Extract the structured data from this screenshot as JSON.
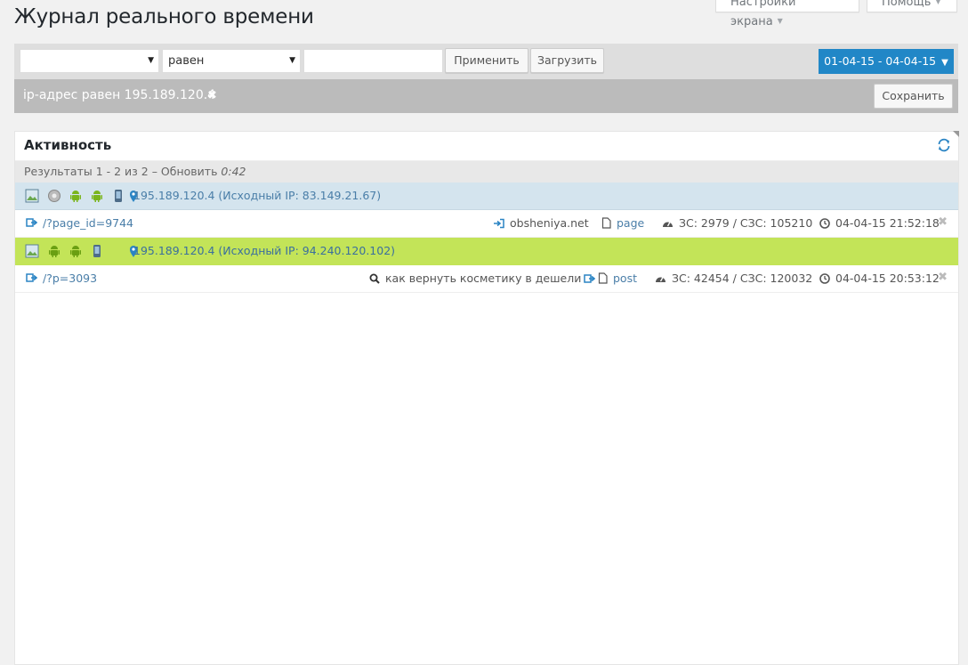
{
  "page": {
    "title": "Журнал реального времени"
  },
  "top_tabs": {
    "screen_options": "Настройки экрана",
    "help": "Помощь"
  },
  "filter": {
    "field_value": "",
    "operator_value": "равен",
    "text_value": "",
    "apply_label": "Применить",
    "load_label": "Загрузить",
    "date_range": "01-04-15 - 04-04-15"
  },
  "active_filter": {
    "tag": "ip-адрес равен 195.189.120.4",
    "save_label": "Сохранить"
  },
  "panel": {
    "title": "Активность",
    "results_text": "Результаты 1 - 2 из 2 – Обновить",
    "results_time": "0:42"
  },
  "visitors": [
    {
      "ip": "195.189.120.4 (Исходный IP: 83.149.21.67)",
      "icons": [
        "screen-res-icon",
        "browser-icon",
        "android-icon",
        "android-icon",
        "mobile-device-icon",
        "location-pin-icon"
      ],
      "hit": {
        "url": "/?page_id=9744",
        "referrer": "obsheniya.net",
        "content_type": "page",
        "stats": "ЗС: 2979 / СЗС: 105210",
        "time": "04-04-15 21:52:18"
      }
    },
    {
      "ip": "195.189.120.4 (Исходный IP: 94.240.120.102)",
      "icons": [
        "screen-res-icon",
        "android-icon",
        "android-icon",
        "mobile-device-icon",
        "location-pin-icon"
      ],
      "hit": {
        "url": "/?p=3093",
        "search_query": "как вернуть косметику в дешели",
        "content_type": "post",
        "stats": "ЗС: 42454 / СЗС: 120032",
        "time": "04-04-15 20:53:12"
      }
    }
  ]
}
